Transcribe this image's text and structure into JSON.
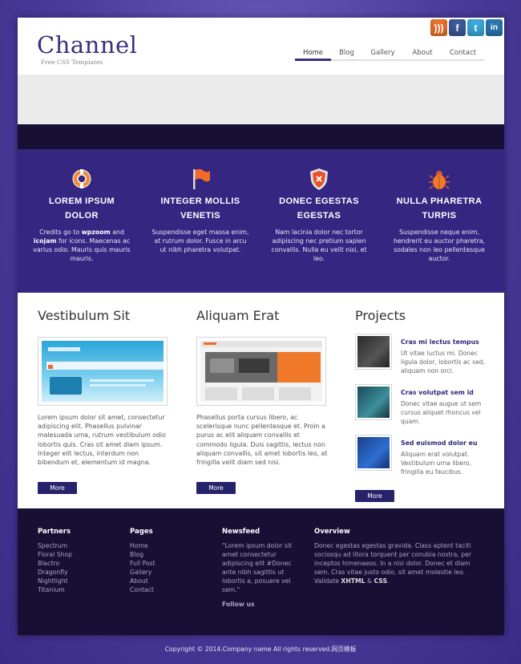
{
  "header": {
    "logo": "Channel",
    "tagline": "Free CSS Templates",
    "nav": [
      {
        "label": "Home",
        "active": true
      },
      {
        "label": "Blog",
        "active": false
      },
      {
        "label": "Gallery",
        "active": false
      },
      {
        "label": "About",
        "active": false
      },
      {
        "label": "Contact",
        "active": false
      }
    ],
    "social": [
      {
        "icon": "rss-icon",
        "glyph": ")))"
      },
      {
        "icon": "facebook-icon",
        "glyph": "f"
      },
      {
        "icon": "twitter-icon",
        "glyph": "t"
      },
      {
        "icon": "linkedin-icon",
        "glyph": "in"
      }
    ]
  },
  "features": [
    {
      "icon": "lifebuoy-icon",
      "title_line1": "LOREM IPSUM",
      "title_line2": "DOLOR",
      "text_pre": "Credits go to ",
      "text_b1": "wpzoom",
      "text_mid": " and ",
      "text_b2": "icojam",
      "text_post": " for icons. Maecenas ac varius odio. Mauris quis mauris mauris."
    },
    {
      "icon": "flag-icon",
      "title_line1": "INTEGER MOLLIS",
      "title_line2": "VENETIS",
      "text": "Suspendisse eget massa enim, at rutrum dolor. Fusce in arcu ut nibh pharetra volutpat."
    },
    {
      "icon": "shield-icon",
      "title_line1": "DONEC EGESTAS",
      "title_line2": "EGESTAS",
      "text": "Nam lacinia dolor nec tortor adipiscing nec pretium sapien convallis. Nulla eu velit nisi, et leo."
    },
    {
      "icon": "bug-icon",
      "title_line1": "NULLA PHARETRA",
      "title_line2": "TURPIS",
      "text": "Suspendisse neque enim, hendrerit eu auctor pharetra, sodales non leo pellentesque auctor."
    }
  ],
  "content": {
    "col1": {
      "title": "Vestibulum Sit",
      "text": "Lorem ipsum dolor sit amet, consectetur adipiscing elit. Phasellus pulvinar malesuada urna, rutrum vestibulum odio lobortis quis. Cras sit amet diam ipsum. Integer elit lectus, interdum non bibendum et, elementum id magna.",
      "button": "More"
    },
    "col2": {
      "title": "Aliquam Erat",
      "text": "Phasellus porta cursus libero, ac scelerisque nunc pellentesque et. Proin a purus ac elit aliquam convallis et commodo ligula. Duis sagittis, lectus non aliquam convallis, sit amet lobortis leo, at fringilla velit diam sed nisi.",
      "button": "More"
    },
    "projects": {
      "title": "Projects",
      "items": [
        {
          "title": "Cras mi lectus tempus",
          "text": "Ut vitae luctus mi. Donec ligula dolor, lobortis ac sed, aliquam non orci."
        },
        {
          "title": "Cras volutpat sem id",
          "text": "Donec vitae augue ut sem cursus aliquet rhoncus vel quam."
        },
        {
          "title": "Sed euismod dolor eu",
          "text": "Aliquam erat volutpat. Vestibulum urna libero, fringilla eu faucibus."
        }
      ],
      "button": "More"
    }
  },
  "footer": {
    "partners": {
      "title": "Partners",
      "links": [
        "Spectrum",
        "Floral Shop",
        "Blactro",
        "Dragonfly",
        "Nightlight",
        "Titanium"
      ]
    },
    "pages": {
      "title": "Pages",
      "links": [
        "Home",
        "Blog",
        "Full Post",
        "Gallery",
        "About",
        "Contact"
      ]
    },
    "newsfeed": {
      "title": "Newsfeed",
      "text": "\"Lorem ipsum dolor sit amet consectetur adipiscing elit #Donec ante nibh sagittis ut lobortis a, posuere vel sem.\"",
      "follow": "Follow us"
    },
    "overview": {
      "title": "Overview",
      "text_pre": "Donec egestas egestas gravida. Class aptent taciti sociosqu ad litora torquent per conubia nostra, per inceptos himenaeos. In a nisi dolor. Donec et diam sem. Cras vitae justo odio, sit amet molestie leo. Validate ",
      "xhtml": "XHTML",
      "amp": " & ",
      "css": "CSS",
      "dot": "."
    }
  },
  "copyright": "Copyright © 2014.Company name All rights reserved.网页模板",
  "colors": {
    "brand": "#3a2f7e",
    "feature_band": "#352682",
    "footer": "#180f35",
    "button": "#27226a"
  }
}
